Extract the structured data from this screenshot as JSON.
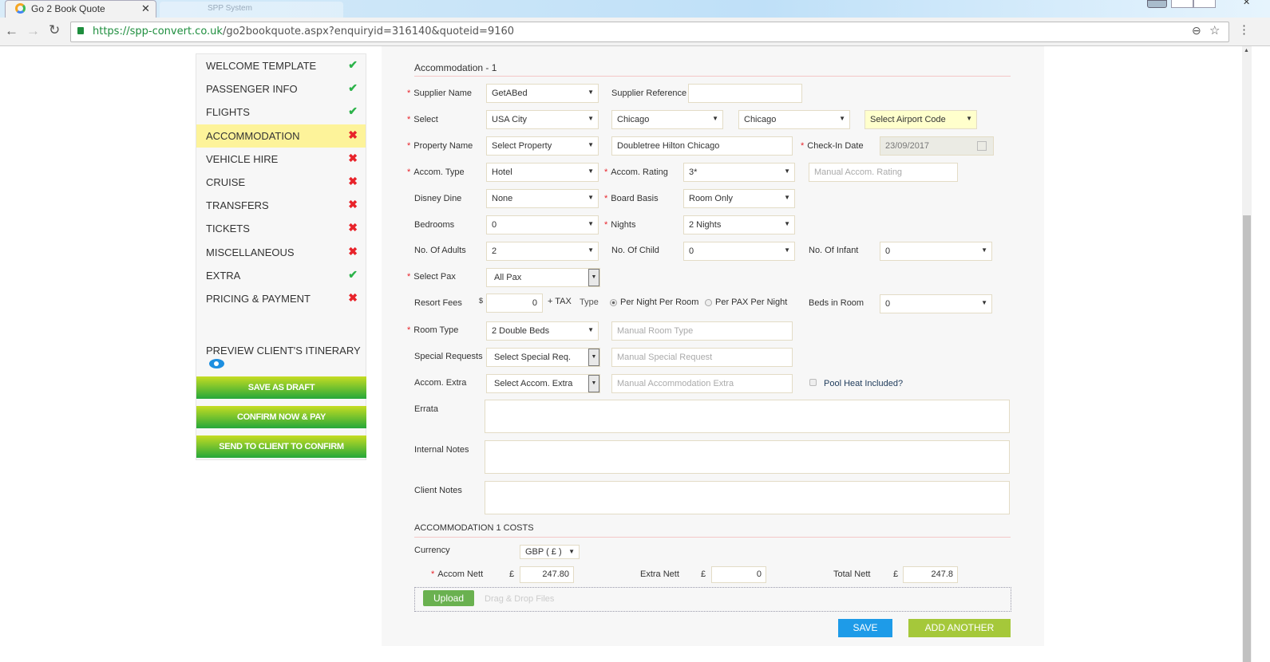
{
  "browser": {
    "tab_title": "Go 2 Book Quote",
    "tab2_title": "SPP System",
    "url_host": "https://spp-convert.co.uk",
    "url_path": "/go2bookquote.aspx?enquiryid=316140&quoteid=9160"
  },
  "sidebar": {
    "items": [
      {
        "label": "WELCOME TEMPLATE",
        "status": "done"
      },
      {
        "label": "PASSENGER INFO",
        "status": "done"
      },
      {
        "label": "FLIGHTS",
        "status": "done"
      },
      {
        "label": "ACCOMMODATION",
        "status": "incomplete"
      },
      {
        "label": "VEHICLE HIRE",
        "status": "incomplete"
      },
      {
        "label": "CRUISE",
        "status": "incomplete"
      },
      {
        "label": "TRANSFERS",
        "status": "incomplete"
      },
      {
        "label": "TICKETS",
        "status": "incomplete"
      },
      {
        "label": "MISCELLANEOUS",
        "status": "incomplete"
      },
      {
        "label": "EXTRA",
        "status": "done"
      },
      {
        "label": "PRICING & PAYMENT",
        "status": "incomplete"
      }
    ],
    "preview": "PREVIEW CLIENT'S ITINERARY",
    "save_draft": "SAVE AS DRAFT",
    "confirm": "CONFIRM NOW & PAY",
    "send": "SEND TO CLIENT TO CONFIRM"
  },
  "form": {
    "title": "Accommodation - 1",
    "supplier_name": {
      "label": "Supplier Name",
      "value": "GetABed"
    },
    "supplier_ref": {
      "label": "Supplier Reference",
      "value": ""
    },
    "select": {
      "label": "Select",
      "v1": "USA City",
      "v2": "Chicago",
      "v3": "Chicago",
      "v4": "Select Airport Code"
    },
    "property": {
      "label": "Property Name",
      "select": "Select Property",
      "value": "Doubletree Hilton Chicago"
    },
    "checkin": {
      "label": "Check-In Date",
      "value": "23/09/2017"
    },
    "accom_type": {
      "label": "Accom. Type",
      "value": "Hotel"
    },
    "accom_rating": {
      "label": "Accom. Rating",
      "value": "3*",
      "manual_placeholder": "Manual Accom. Rating"
    },
    "disney_dine": {
      "label": "Disney Dine",
      "value": "None"
    },
    "board_basis": {
      "label": "Board Basis",
      "value": "Room Only"
    },
    "bedrooms": {
      "label": "Bedrooms",
      "value": "0"
    },
    "nights": {
      "label": "Nights",
      "value": "2 Nights"
    },
    "adults": {
      "label": "No. Of Adults",
      "value": "2"
    },
    "child": {
      "label": "No. Of Child",
      "value": "0"
    },
    "infant": {
      "label": "No. Of Infant",
      "value": "0"
    },
    "pax": {
      "label": "Select Pax",
      "value": "All Pax"
    },
    "resort": {
      "label": "Resort Fees",
      "currency": "$",
      "value": "0",
      "tax": "+ TAX",
      "type_label": "Type",
      "opt1": "Per Night Per Room",
      "opt2": "Per PAX Per Night"
    },
    "beds": {
      "label": "Beds in Room",
      "value": "0"
    },
    "room_type": {
      "label": "Room Type",
      "value": "2 Double Beds",
      "placeholder": "Manual Room Type"
    },
    "special": {
      "label": "Special Requests",
      "value": "Select Special Req.",
      "placeholder": "Manual Special Request"
    },
    "extra": {
      "label": "Accom. Extra",
      "value": "Select Accom. Extra",
      "placeholder": "Manual Accommodation Extra",
      "pool": "Pool Heat Included?"
    },
    "errata": "Errata",
    "internal": "Internal Notes",
    "client": "Client Notes"
  },
  "costs": {
    "title": "ACCOMMODATION 1 COSTS",
    "currency_label": "Currency",
    "currency": "GBP ( £ )",
    "symbol": "£",
    "accom_label": "Accom Nett",
    "accom": "247.80",
    "extra_label": "Extra Nett",
    "extra": "0",
    "total_label": "Total Nett",
    "total": "247.8",
    "upload": "Upload",
    "drop": "Drag & Drop Files",
    "save": "SAVE",
    "add": "ADD ANOTHER"
  }
}
